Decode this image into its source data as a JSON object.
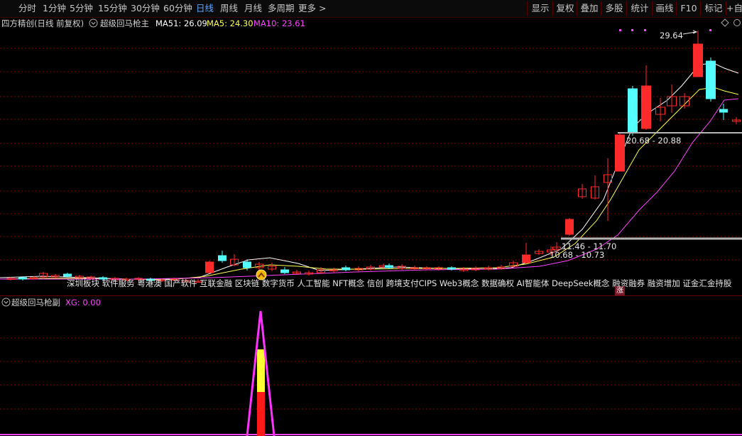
{
  "toolbar": {
    "periods": [
      "分时",
      "1分钟",
      "5分钟",
      "15分钟",
      "30分钟",
      "60分钟",
      "日线",
      "周线",
      "月线",
      "多周期",
      "更多 >"
    ],
    "active_period": "日线",
    "tools": [
      "显示",
      "复权",
      "叠加",
      "多股",
      "统计",
      "画线",
      "F10",
      "标记",
      "+自"
    ]
  },
  "main_header": {
    "stock_name": "四方精创(日线 前复权)",
    "indicator_name": "超级回马枪主",
    "ma51_label": "MA51: 26.09",
    "ma5_label": "MA5: 24.30",
    "ma10_label": "MA10: 23.61"
  },
  "price_labels": {
    "high": "29.64",
    "zone_upper": "20.68 - 20.88",
    "zone_lower1": "11.46 - 11.70",
    "zone_lower2": "10.68 - 10.73"
  },
  "concepts": "深圳板块 软件服务 粤港澳 国产软件 互联金融 区块链 数字货币 人工智能 NFT概念 信创 跨境支付CIPS Web3概念 数据确权 AI智能体 DeepSeek概念 融资融券 融资增加 证金汇金持股",
  "zhang_badge": "涨",
  "sub_header": {
    "indicator_name": "超级回马枪副",
    "xg_label": "XG: 0.00"
  },
  "colors": {
    "up": "#ff2a2a",
    "down": "#54ffff",
    "ma5": "#ffffff",
    "ma10": "#ffff55",
    "ma51": "#ff44ff",
    "active_period": "#5aa7ff",
    "grid": "#800000"
  },
  "icons": {
    "dropdown": "chevron-circle-icon",
    "signal": "signal-marker-icon",
    "diamond": "diamond-icon"
  }
}
